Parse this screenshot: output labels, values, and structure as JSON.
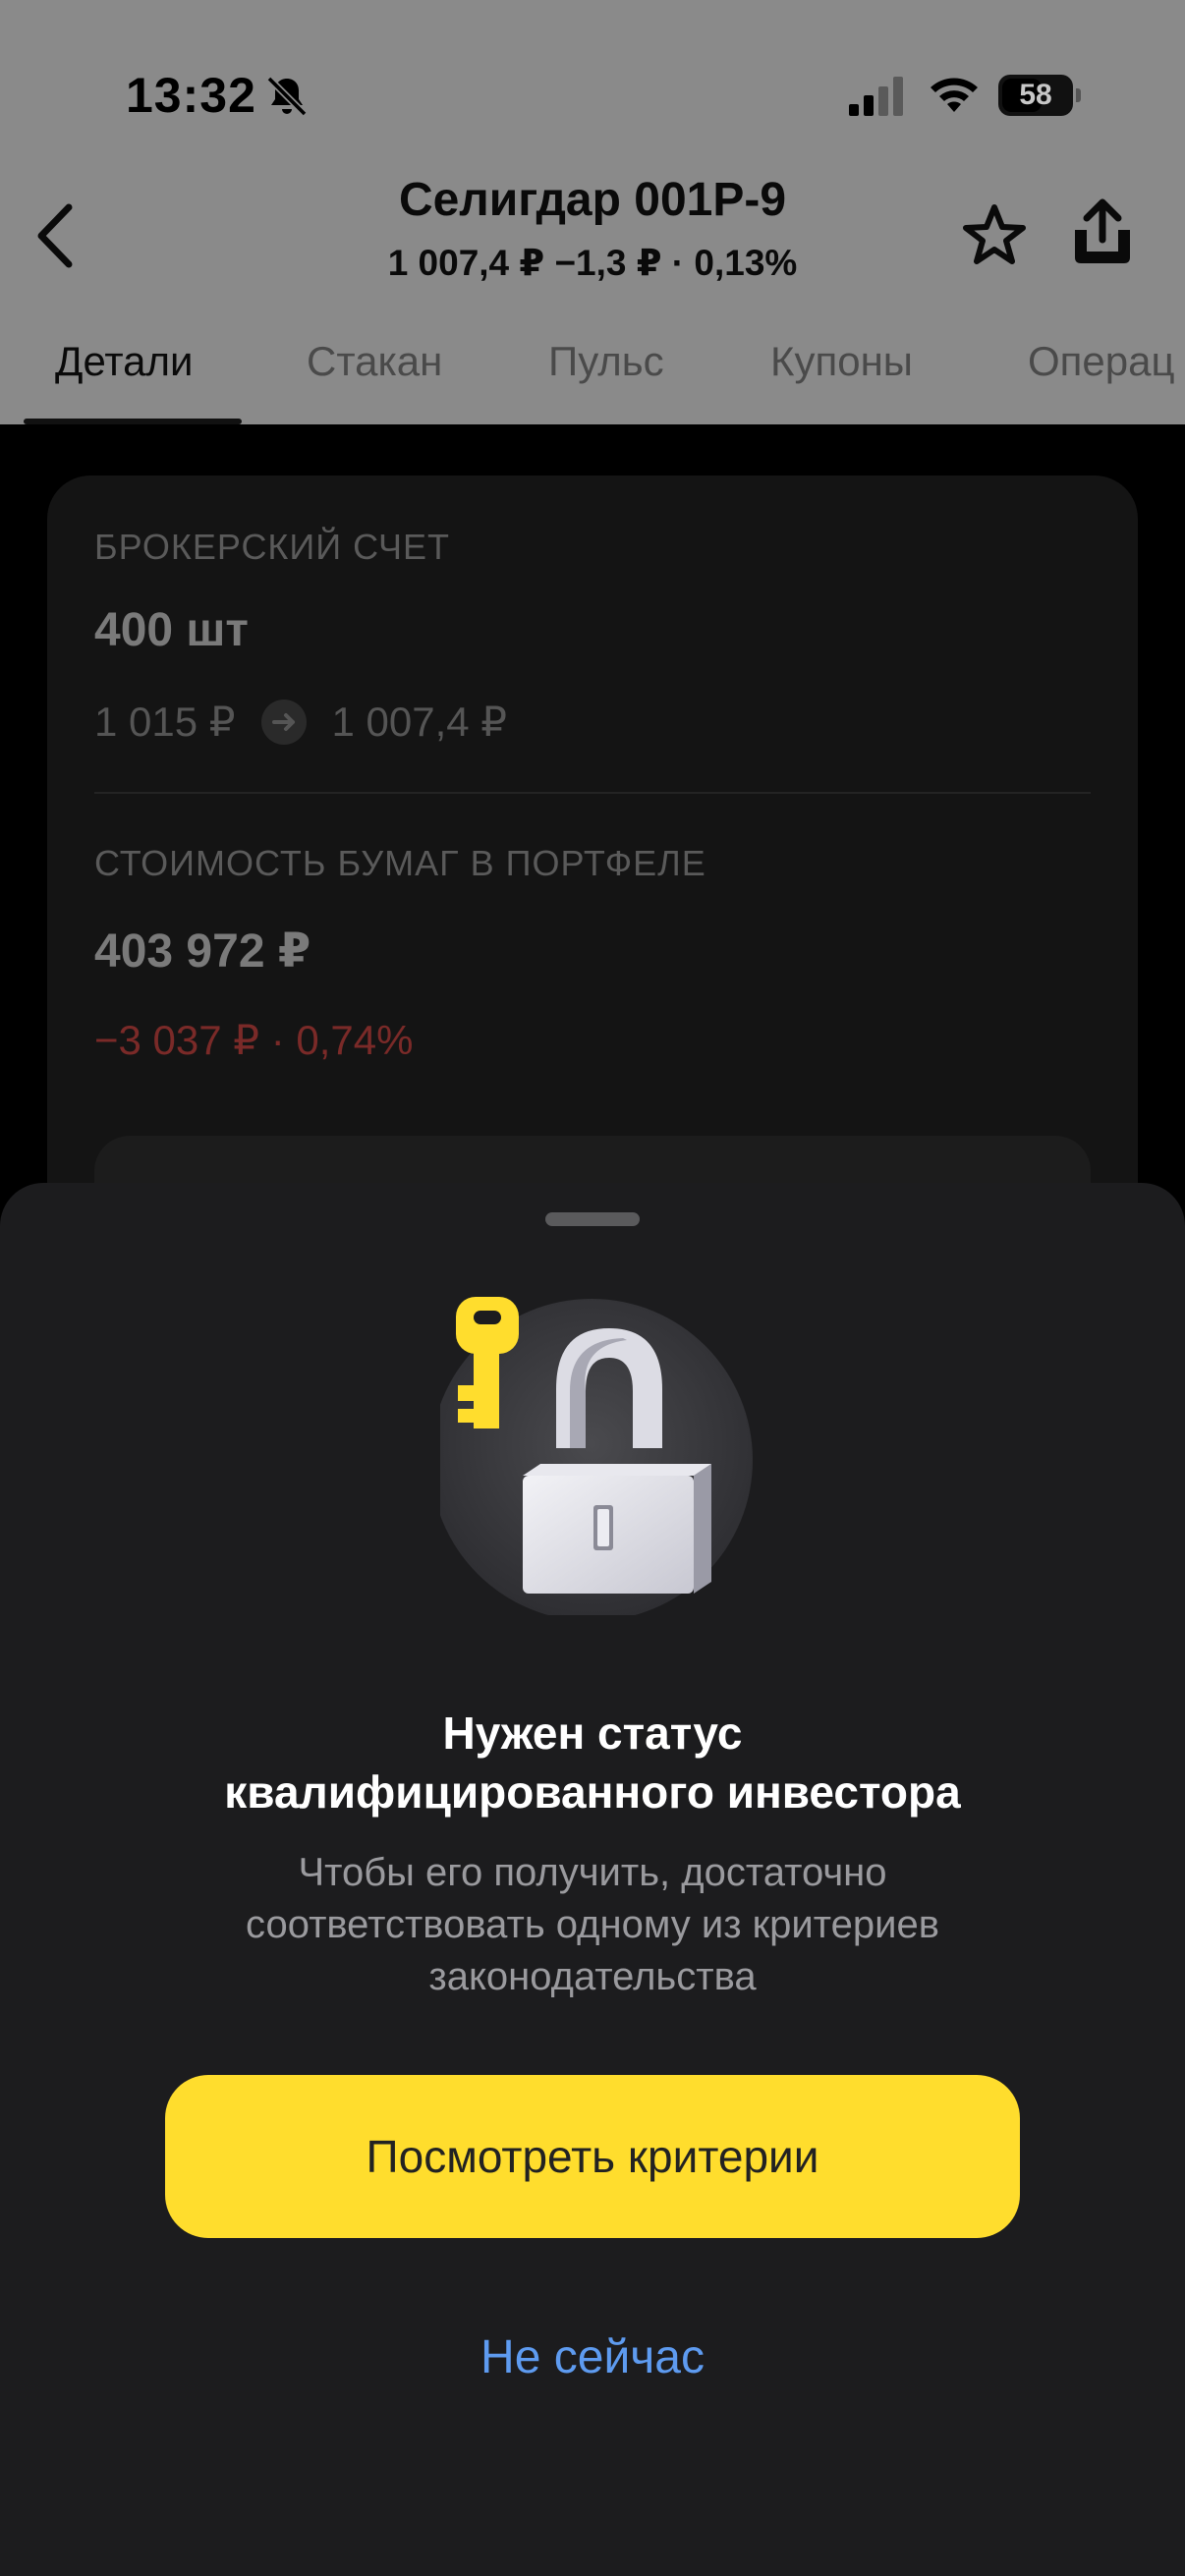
{
  "status_bar": {
    "time": "13:32",
    "battery": "58"
  },
  "header": {
    "title": "Селигдар 001Р-9",
    "subtitle": "1 007,4 ₽  −1,3 ₽ · 0,13%"
  },
  "tabs": [
    {
      "label": "Детали"
    },
    {
      "label": "Стакан"
    },
    {
      "label": "Пульс"
    },
    {
      "label": "Купоны"
    },
    {
      "label": "Операц"
    }
  ],
  "card": {
    "account_label": "БРОКЕРСКИЙ СЧЕТ",
    "quantity": "400 шт",
    "price_from": "1 015 ₽",
    "price_to": "1 007,4 ₽",
    "value_label": "СТОИМОСТЬ БУМАГ В ПОРТФЕЛЕ",
    "value": "403 972 ₽",
    "change": "−3 037 ₽ · 0,74%"
  },
  "sheet": {
    "title_line1": "Нужен статус",
    "title_line2": "квалифицированного инвестора",
    "desc_line1": "Чтобы его получить, достаточно",
    "desc_line2": "соответствовать одному из критериев",
    "desc_line3": "законодательства",
    "primary_button": "Посмотреть критерии",
    "secondary_button": "Не сейчас"
  },
  "colors": {
    "accent_yellow": "#ffdd2d",
    "link_blue": "#5e9bf0",
    "sheet_bg": "#1c1c1e",
    "negative_red": "#7a2a28"
  },
  "icons": [
    "bell-off-icon",
    "signal-icon",
    "wifi-icon",
    "battery-icon",
    "back-arrow-icon",
    "star-icon",
    "share-icon",
    "arrow-right-icon",
    "key-icon",
    "lock-icon"
  ]
}
